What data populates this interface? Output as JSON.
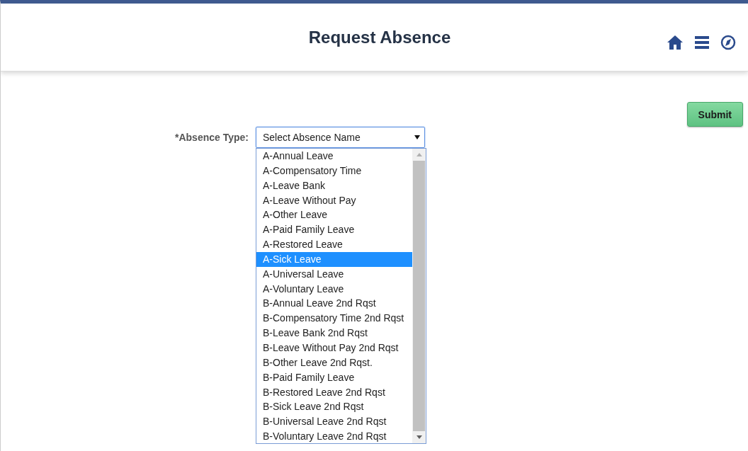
{
  "header": {
    "title": "Request Absence"
  },
  "toolbar": {
    "submit": "Submit"
  },
  "absence_type": {
    "label": "*Absence Type:",
    "value": "Select Absence Name",
    "expanded": true,
    "options": [
      {
        "label": "A-Annual Leave",
        "selected": false
      },
      {
        "label": "A-Compensatory Time",
        "selected": false
      },
      {
        "label": "A-Leave Bank",
        "selected": false
      },
      {
        "label": "A-Leave Without Pay",
        "selected": false
      },
      {
        "label": "A-Other Leave",
        "selected": false
      },
      {
        "label": "A-Paid Family Leave",
        "selected": false
      },
      {
        "label": "A-Restored Leave",
        "selected": false
      },
      {
        "label": "A-Sick Leave",
        "selected": true
      },
      {
        "label": "A-Universal Leave",
        "selected": false
      },
      {
        "label": "A-Voluntary Leave",
        "selected": false
      },
      {
        "label": "B-Annual Leave 2nd Rqst",
        "selected": false
      },
      {
        "label": "B-Compensatory Time 2nd Rqst",
        "selected": false
      },
      {
        "label": "B-Leave Bank 2nd Rqst",
        "selected": false
      },
      {
        "label": "B-Leave Without Pay 2nd Rqst",
        "selected": false
      },
      {
        "label": "B-Other Leave 2nd Rqst.",
        "selected": false
      },
      {
        "label": "B-Paid Family Leave",
        "selected": false
      },
      {
        "label": "B-Restored Leave 2nd Rqst",
        "selected": false
      },
      {
        "label": "B-Sick Leave 2nd Rqst",
        "selected": false
      },
      {
        "label": "B-Universal Leave 2nd Rqst",
        "selected": false
      },
      {
        "label": "B-Voluntary Leave 2nd Rqst",
        "selected": false
      }
    ]
  }
}
